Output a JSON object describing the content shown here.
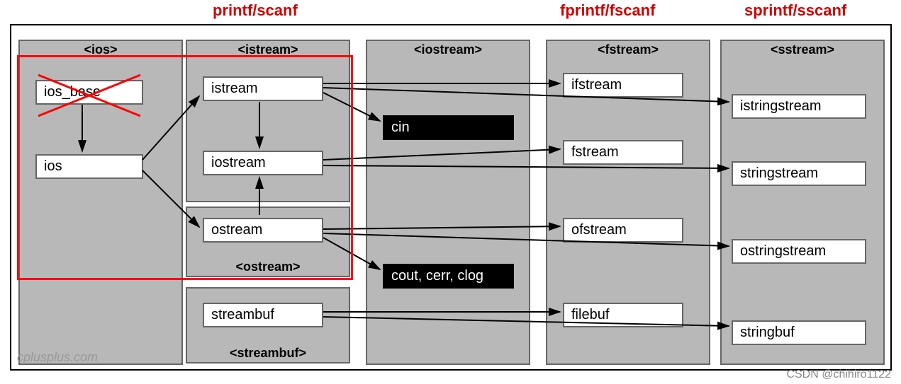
{
  "top_labels": {
    "printf": "printf/scanf",
    "fprintf": "fprintf/fscanf",
    "sprintf": "sprintf/sscanf"
  },
  "columns": {
    "ios": {
      "header": "<ios>"
    },
    "istream": {
      "header": "<istream>"
    },
    "ostream": {
      "header": "<ostream>"
    },
    "streambuf": {
      "header": "<streambuf>"
    },
    "iostream": {
      "header": "<iostream>"
    },
    "fstream": {
      "header": "<fstream>"
    },
    "sstream": {
      "header": "<sstream>"
    }
  },
  "nodes": {
    "ios_base": "ios_base",
    "ios": "ios",
    "istream": "istream",
    "iostream": "iostream",
    "ostream": "ostream",
    "streambuf": "streambuf",
    "cin": "cin",
    "cout": "cout, cerr, clog",
    "ifstream": "ifstream",
    "fstream": "fstream",
    "ofstream": "ofstream",
    "filebuf": "filebuf",
    "istringstream": "istringstream",
    "stringstream": "stringstream",
    "ostringstream": "ostringstream",
    "stringbuf": "stringbuf"
  },
  "watermarks": {
    "bl": "cplusplus.com",
    "br": "CSDN @chihiro1122"
  }
}
